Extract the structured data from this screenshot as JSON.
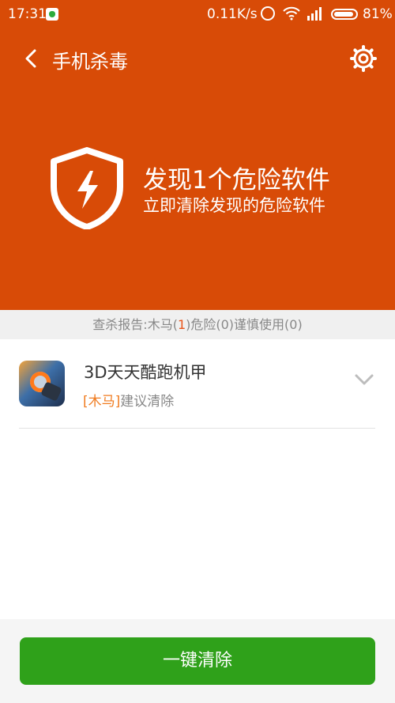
{
  "status_bar": {
    "time": "17:31",
    "speed": "0.11K/s",
    "battery": "81%"
  },
  "header": {
    "title": "手机杀毒"
  },
  "hero": {
    "headline": "发现1个危险软件",
    "subline": "立即清除发现的危险软件"
  },
  "report": {
    "prefix": "查杀报告:木马(",
    "trojan_count": "1",
    "suffix": ")危险(0)谨慎使用(0)"
  },
  "items": [
    {
      "name": "3D天天酷跑机甲",
      "tag": "[木马]",
      "advice": "建议清除"
    }
  ],
  "action": {
    "label": "一键清除"
  },
  "colors": {
    "brand": "#d84b07",
    "button": "#2fa11a",
    "warning": "#f07b1f"
  }
}
